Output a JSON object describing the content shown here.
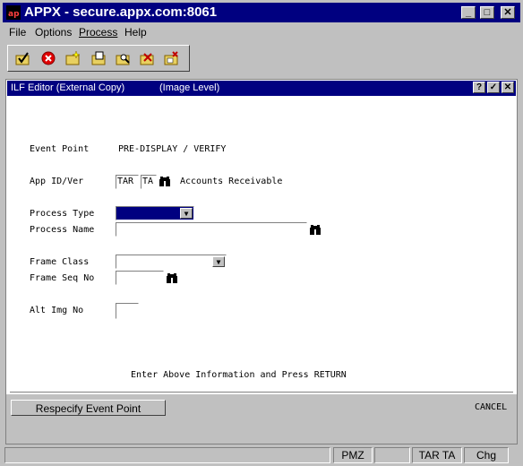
{
  "window": {
    "title": "APPX - secure.appx.com:8061"
  },
  "menu": {
    "file": "File",
    "options": "Options",
    "process": "Process",
    "help": "Help"
  },
  "toolbar": {
    "icons": [
      "check-folder-icon",
      "stop-icon",
      "new-folder-icon",
      "open-folder-icon",
      "search-folder-icon",
      "cancel-folder-icon",
      "delete-folder-icon"
    ]
  },
  "editor": {
    "title": "ILF Editor (External Copy)",
    "level": "(Image Level)",
    "event_point_label": "Event Point",
    "event_point_value": "PRE-DISPLAY / VERIFY",
    "app_id_label": "App ID/Ver",
    "app_id_value": "TAR",
    "app_ver_value": "TA",
    "app_name": "Accounts Receivable",
    "process_type_label": "Process Type",
    "process_type_value": "",
    "process_name_label": "Process Name",
    "process_name_value": "",
    "frame_class_label": "Frame Class",
    "frame_class_value": "",
    "frame_seq_label": "Frame Seq No",
    "frame_seq_value": "",
    "alt_img_label": "Alt Img No",
    "alt_img_value": "",
    "prompt": "Enter Above Information and Press RETURN",
    "respecify_button": "Respecify Event Point",
    "cancel": "CANCEL"
  },
  "status": {
    "panel1": "",
    "panel2": "PMZ",
    "panel3": "",
    "panel4": "TAR TA",
    "panel5": "Chg"
  },
  "colors": {
    "titlebar": "#000080",
    "face": "#c0c0c0",
    "selected": "#000080"
  }
}
